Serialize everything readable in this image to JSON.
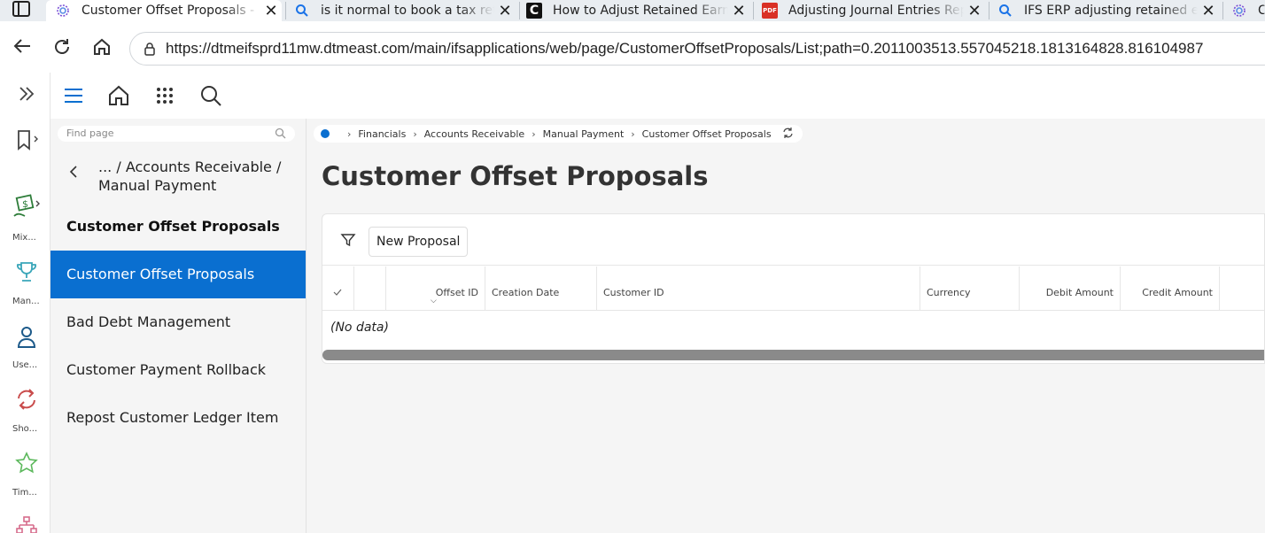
{
  "browser": {
    "tabs": [
      {
        "label": "Customer Offset Proposals - ",
        "icon": "ifs-swirl-icon",
        "active": true
      },
      {
        "label": "is it normal to book a tax ret",
        "icon": "bing-search-icon"
      },
      {
        "label": "How to Adjust Retained Earn",
        "icon": "c-logo-icon"
      },
      {
        "label": "Adjusting Journal Entries Rep",
        "icon": "pdf-icon"
      },
      {
        "label": "IFS ERP adjusting retained ea",
        "icon": "bing-search-icon"
      },
      {
        "label": "C",
        "icon": "ifs-swirl-icon"
      }
    ],
    "url": "https://dtmeifsprd11mw.dtmeast.com/main/ifsapplications/web/page/CustomerOffsetProposals/List;path=0.2011003513.557045218.1813164828.816104987"
  },
  "rail": {
    "items": [
      {
        "label": "Mix..."
      },
      {
        "label": "Man..."
      },
      {
        "label": "Use..."
      },
      {
        "label": "Sho..."
      },
      {
        "label": "Tim..."
      }
    ]
  },
  "navigator": {
    "find_placeholder": "Find page",
    "path": "... / Accounts Receivable / Manual Payment",
    "heading": "Customer Offset Proposals",
    "items": [
      {
        "label": "Customer Offset Proposals",
        "selected": true
      },
      {
        "label": "Bad Debt Management"
      },
      {
        "label": "Customer Payment Rollback"
      },
      {
        "label": "Repost Customer Ledger Item"
      }
    ]
  },
  "breadcrumb": {
    "items": [
      "Financials",
      "Accounts Receivable",
      "Manual Payment",
      "Customer Offset Proposals"
    ]
  },
  "page": {
    "title": "Customer Offset Proposals",
    "new_button": "New Proposal",
    "columns": [
      "Offset ID",
      "Creation Date",
      "Customer ID",
      "Currency",
      "Debit Amount",
      "Credit Amount"
    ],
    "empty_text": "(No data)"
  },
  "colors": {
    "accent": "#0a6fd0"
  }
}
